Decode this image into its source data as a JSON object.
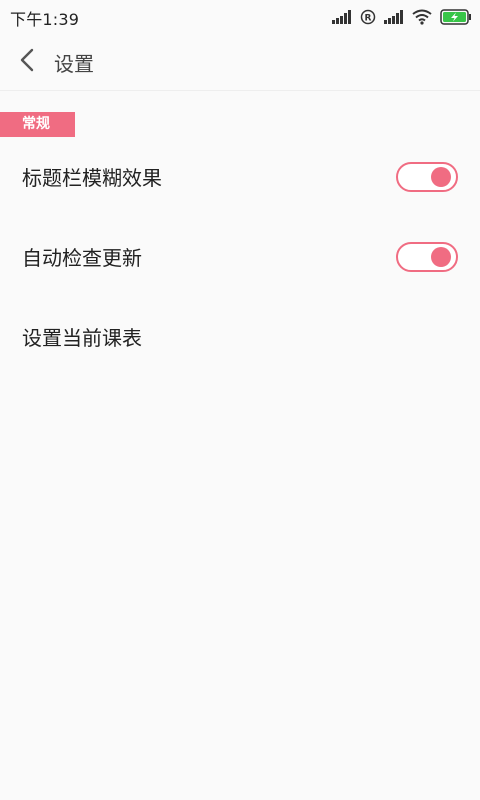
{
  "status_bar": {
    "time": "下午1:39",
    "icons": [
      "signal-icon",
      "roaming-icon",
      "signal-icon",
      "wifi-icon",
      "battery-charging-icon"
    ],
    "roaming_label": "R",
    "battery_color": "#38c548"
  },
  "header": {
    "back_icon": "chevron-left-icon",
    "title": "设置"
  },
  "section": {
    "label": "常规",
    "color": "#f06c82"
  },
  "settings": [
    {
      "label": "标题栏模糊效果",
      "type": "toggle",
      "on": true
    },
    {
      "label": "自动检查更新",
      "type": "toggle",
      "on": true
    },
    {
      "label": "设置当前课表",
      "type": "action"
    }
  ],
  "theme": {
    "accent": "#f06c82",
    "background": "#fafafa"
  }
}
